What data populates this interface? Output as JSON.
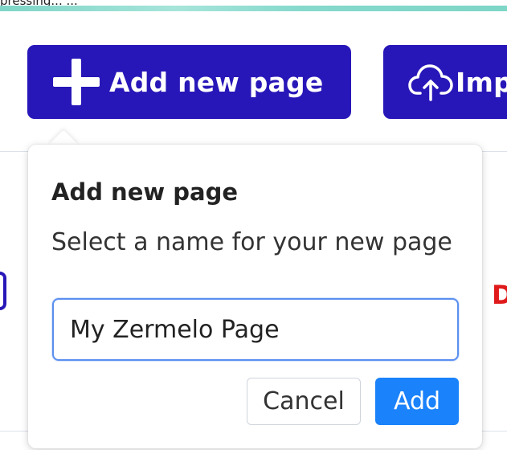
{
  "topbar": {
    "partial_text": "pressing... ..."
  },
  "colors": {
    "primary_button": "#2817b8",
    "add_button": "#1a82fb",
    "input_focus": "#5b8ff0",
    "accent_bar": "#7ed6c7",
    "danger_text": "#e01a1a"
  },
  "toolbar": {
    "add_page_label": "Add new page",
    "import_label": "Imp",
    "add_page_icon": "plus-icon",
    "import_icon": "cloud-upload-icon"
  },
  "background": {
    "right_partial_letter": "D"
  },
  "popover": {
    "title": "Add new page",
    "description": "Select a name for your new page",
    "input_value": "My Zermelo Page",
    "cancel_label": "Cancel",
    "add_label": "Add"
  }
}
